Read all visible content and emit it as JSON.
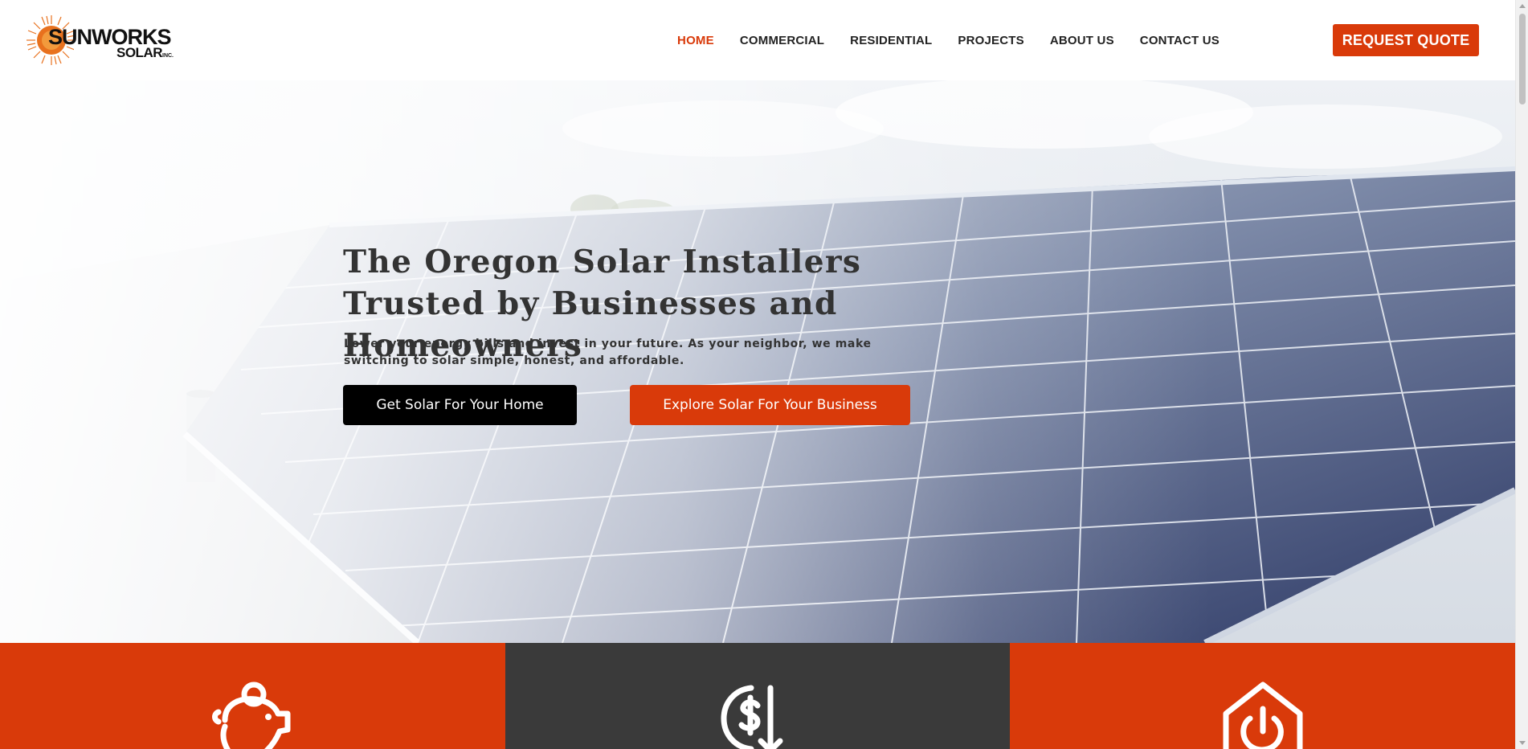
{
  "brand": {
    "name_line1": "SUNWORKS",
    "name_line2": "SOLAR",
    "name_suffix": "INC.",
    "logo_icon": "sun-icon"
  },
  "nav": {
    "items": [
      {
        "label": "HOME",
        "active": true
      },
      {
        "label": "COMMERCIAL",
        "active": false
      },
      {
        "label": "RESIDENTIAL",
        "active": false
      },
      {
        "label": "PROJECTS",
        "active": false
      },
      {
        "label": "ABOUT US",
        "active": false
      },
      {
        "label": "CONTACT US",
        "active": false
      }
    ],
    "cta_label": "REQUEST QUOTE"
  },
  "hero": {
    "title": "The Oregon Solar Installers Trusted by Businesses and Homeowners",
    "subtitle": "Lower your energy bills and invest in your future. As your neighbor, we make switching to solar simple, honest, and affordable.",
    "primary_button": "Get Solar For Your Home",
    "secondary_button": "Explore Solar For Your Business"
  },
  "features": [
    {
      "icon": "piggy-bank-icon",
      "color": "orange"
    },
    {
      "icon": "dollar-down-icon",
      "color": "dark"
    },
    {
      "icon": "power-house-icon",
      "color": "orange"
    }
  ],
  "colors": {
    "accent": "#d93a0a",
    "dark": "#3a3a3a",
    "text": "#333333"
  }
}
